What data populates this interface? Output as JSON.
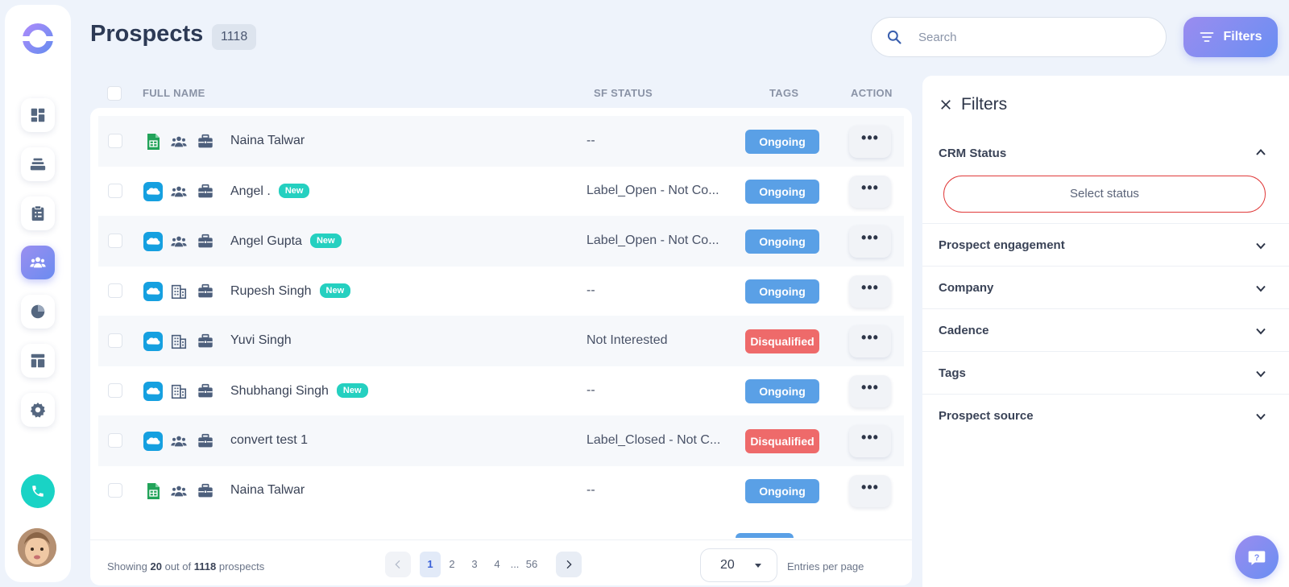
{
  "header": {
    "title": "Prospects",
    "count": "1118",
    "search_placeholder": "Search",
    "filters_label": "Filters"
  },
  "sidebar": {
    "items": [
      {
        "name": "dashboard",
        "icon": "dashboard-icon"
      },
      {
        "name": "layers",
        "icon": "layers-icon"
      },
      {
        "name": "tasks",
        "icon": "clipboard-icon"
      },
      {
        "name": "prospects",
        "icon": "users-icon",
        "active": true
      },
      {
        "name": "reports",
        "icon": "pie-chart-icon"
      },
      {
        "name": "templates",
        "icon": "layout-icon"
      },
      {
        "name": "settings",
        "icon": "gear-icon"
      }
    ],
    "phone_icon": "phone-icon"
  },
  "table": {
    "columns": {
      "full_name": "FULL NAME",
      "sf_status": "SF STATUS",
      "tags": "TAGS",
      "action": "ACTION"
    },
    "rows": [
      {
        "source": "sheets",
        "type": "team",
        "name": "Naina Talwar",
        "new": "",
        "sf_status": "--",
        "tag": "Ongoing",
        "tag_kind": "ongoing"
      },
      {
        "source": "salesforce",
        "type": "team",
        "name": "Angel .",
        "new": "New",
        "sf_status": "Label_Open - Not Co...",
        "tag": "Ongoing",
        "tag_kind": "ongoing"
      },
      {
        "source": "salesforce",
        "type": "team",
        "name": "Angel Gupta",
        "new": "New",
        "sf_status": "Label_Open - Not Co...",
        "tag": "Ongoing",
        "tag_kind": "ongoing"
      },
      {
        "source": "salesforce",
        "type": "building",
        "name": "Rupesh Singh",
        "new": "New",
        "sf_status": "--",
        "tag": "Ongoing",
        "tag_kind": "ongoing"
      },
      {
        "source": "salesforce",
        "type": "building",
        "name": "Yuvi Singh",
        "new": "",
        "sf_status": "Not Interested",
        "tag": "Disqualified",
        "tag_kind": "disq"
      },
      {
        "source": "salesforce",
        "type": "building",
        "name": "Shubhangi Singh",
        "new": "New",
        "sf_status": "--",
        "tag": "Ongoing",
        "tag_kind": "ongoing"
      },
      {
        "source": "salesforce",
        "type": "team",
        "name": "convert test 1",
        "new": "",
        "sf_status": "Label_Closed - Not C...",
        "tag": "Disqualified",
        "tag_kind": "disq"
      },
      {
        "source": "sheets",
        "type": "team",
        "name": "Naina Talwar",
        "new": "",
        "sf_status": "--",
        "tag": "Ongoing",
        "tag_kind": "ongoing"
      }
    ],
    "action_label": "•••"
  },
  "footer": {
    "showing_prefix": "Showing",
    "showing_count": "20",
    "showing_mid": "out of",
    "showing_total": "1118",
    "showing_suffix": "prospects",
    "pages": [
      "1",
      "2",
      "3",
      "4"
    ],
    "ellipsis": "...",
    "last_page": "56",
    "per_page": "20",
    "entries_label": "Entries per page"
  },
  "filters_panel": {
    "title": "Filters",
    "crm_status": "CRM Status",
    "select_status": "Select status",
    "sections": [
      "Prospect engagement",
      "Company",
      "Cadence",
      "Tags",
      "Prospect source"
    ]
  },
  "colors": {
    "accent": "#7b8df0",
    "ongoing": "#5aa0e6",
    "disqualified": "#ee6a6a",
    "new_badge": "#25d0c0",
    "teal": "#19d3c5"
  }
}
